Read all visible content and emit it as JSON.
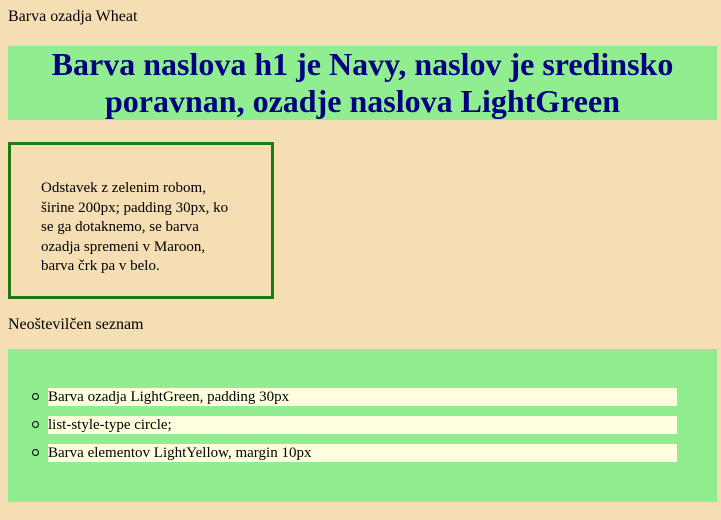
{
  "page": {
    "intro_text": "Barva ozadja Wheat",
    "heading": "Barva naslova h1 je Navy, naslov je sredinsko poravnan, ozadje naslova LightGreen",
    "paragraph_box": "Odstavek z zelenim robom, širine 200px; padding 30px, ko se ga dotaknemo, se barva ozadja spremeni v Maroon, barva črk pa v belo.",
    "list_label": "Neoštevilčen seznam",
    "list_items": [
      "Barva ozadja LightGreen, padding 30px",
      "list-style-type circle;",
      "Barva elementov LightYellow, margin 10px"
    ]
  },
  "colors": {
    "page_background": "#F5DEB3",
    "heading_color": "#000080",
    "heading_background": "#90EE90",
    "box_border": "#1F7A12",
    "list_background": "#90EE90",
    "list_item_background": "#FFFFE0"
  }
}
